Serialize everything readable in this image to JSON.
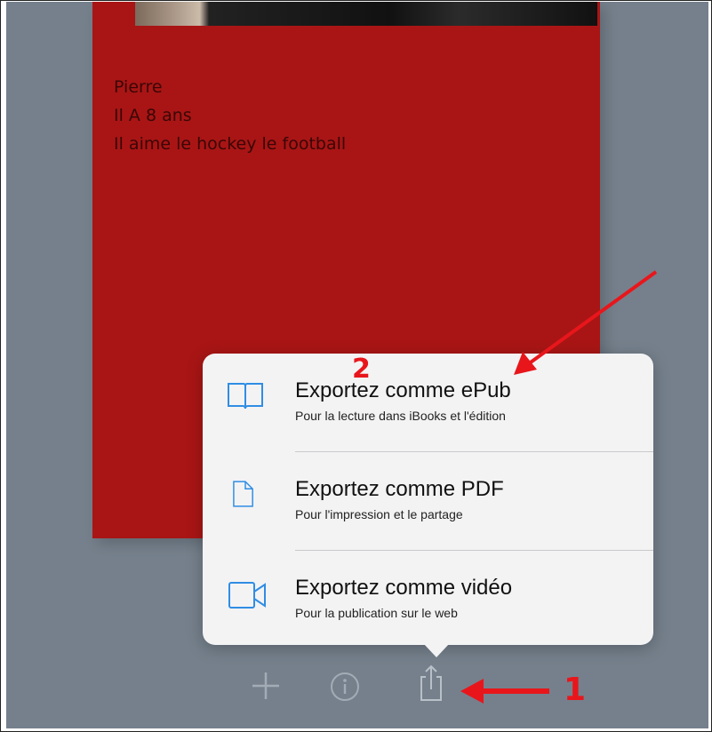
{
  "document": {
    "lines": [
      "Pierre",
      "Il A 8 ans",
      "Il aime le hockey le football"
    ]
  },
  "export_menu": {
    "items": [
      {
        "title": "Exportez comme ePub",
        "subtitle": "Pour la lecture dans iBooks et l'édition",
        "icon": "book-icon"
      },
      {
        "title": "Exportez comme PDF",
        "subtitle": "Pour l'impression et le partage",
        "icon": "document-icon"
      },
      {
        "title": "Exportez comme vidéo",
        "subtitle": "Pour la publication sur le web",
        "icon": "video-camera-icon"
      }
    ]
  },
  "toolbar": {
    "buttons": [
      "plus-icon",
      "info-icon",
      "share-icon"
    ]
  },
  "annotations": {
    "step1": "1",
    "step2": "2"
  },
  "colors": {
    "background": "#75808c",
    "page": "#a91515",
    "accent_blue": "#2f8de4",
    "annotation_red": "#e8161b"
  }
}
